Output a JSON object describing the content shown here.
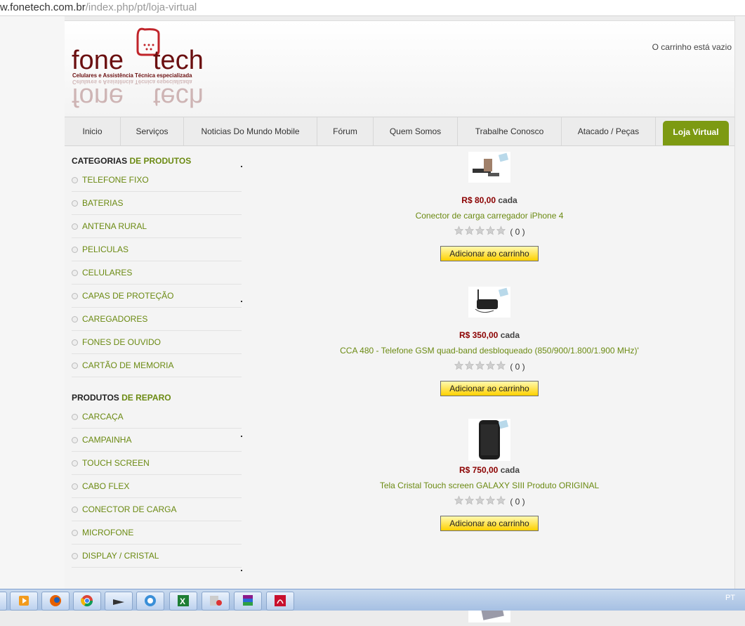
{
  "browser": {
    "url_host": "w.fonetech.com.br",
    "url_path": "/index.php/pt/loja-virtual"
  },
  "header": {
    "logo_text_left": "fone",
    "logo_text_right": "tech",
    "logo_tagline": "Celulares e Assistência Técnica especializada",
    "cart_status": "O carrinho está vazio"
  },
  "nav": [
    {
      "label": "Inicio"
    },
    {
      "label": "Serviços"
    },
    {
      "label": "Noticias Do Mundo Mobile"
    },
    {
      "label": "Fórum"
    },
    {
      "label": "Quem Somos"
    },
    {
      "label": "Trabalhe Conosco"
    },
    {
      "label": "Atacado / Peças"
    },
    {
      "label": "Loja Virtual",
      "active": true
    }
  ],
  "sidebar": {
    "products_title_a": "CATEGORIAS",
    "products_title_b": " DE PRODUTOS",
    "products": [
      "TELEFONE FIXO",
      "BATERIAS",
      "ANTENA RURAL",
      "PELICULAS",
      "CELULARES",
      "CAPAS DE PROTEÇÃO",
      "CAREGADORES",
      "FONES DE OUVIDO",
      "CARTÃO DE MEMORIA"
    ],
    "repair_title_a": "PRODUTOS",
    "repair_title_b": " DE REPARO",
    "repair": [
      "CARCAÇA",
      "CAMPAINHA",
      "TOUCH SCREEN",
      "CABO FLEX",
      "CONECTOR DE CARGA",
      "MICROFONE",
      "DISPLAY / CRISTAL"
    ]
  },
  "products": [
    {
      "price": "R$ 80,00",
      "unit": "cada",
      "name": "Conector de carga carregador iPhone 4",
      "rating_count": "( 0 )",
      "button": "Adicionar ao carrinho",
      "stars": 0
    },
    {
      "price": "R$ 350,00",
      "unit": "cada",
      "name": "CCA 480 - Telefone GSM quad-band desbloqueado (850/900/1.800/1.900 MHz)'",
      "rating_count": "( 0 )",
      "button": "Adicionar ao carrinho",
      "stars": 0
    },
    {
      "price": "R$ 750,00",
      "unit": "cada",
      "name": "Tela Cristal Touch screen GALAXY SIII Produto ORIGINAL",
      "rating_count": "( 0 )",
      "button": "Adicionar ao carrinho",
      "stars": 0
    }
  ],
  "taskbar": {
    "language": "PT"
  },
  "colors": {
    "accent": "#6b8a12",
    "nav_active": "#7d9a12",
    "price": "#8b0000",
    "button": "#ffd100",
    "logo": "#6b0f10"
  }
}
